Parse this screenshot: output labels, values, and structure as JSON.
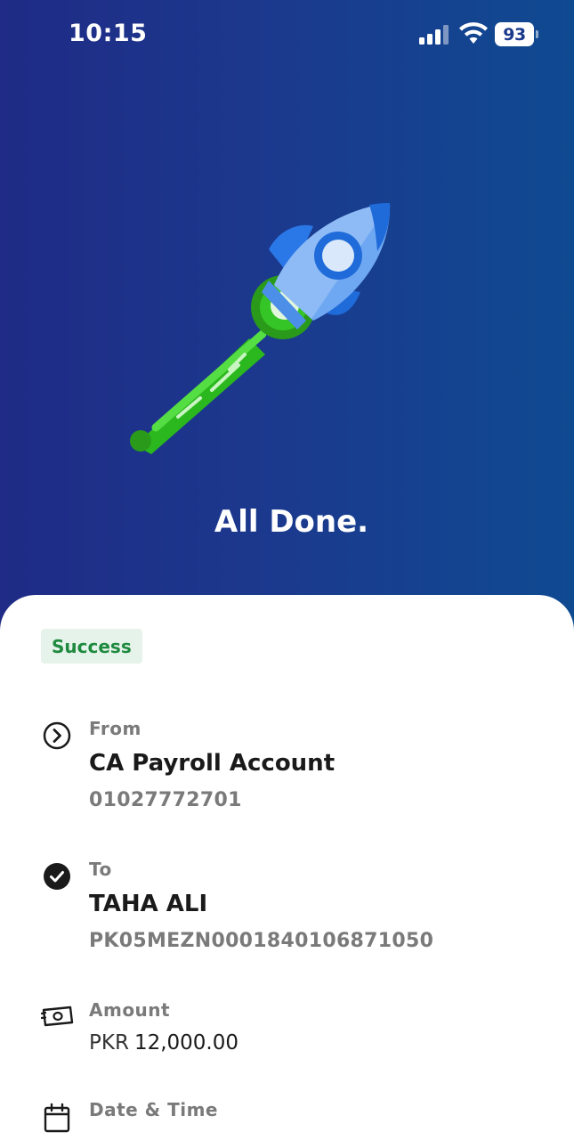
{
  "status_bar": {
    "time": "10:15",
    "battery": "93",
    "icons": [
      "signal-icon",
      "wifi-icon",
      "battery-icon"
    ]
  },
  "hero": {
    "title": "All Done.",
    "illustration": "rocket-illustration",
    "colors": {
      "gradient_start": "#1f2b86",
      "gradient_end": "#0f4a91"
    }
  },
  "status_badge": {
    "label": "Success",
    "color": "#1e8a3f"
  },
  "details": {
    "from": {
      "label": "From",
      "name": "CA Payroll Account",
      "account": "01027772701",
      "icon": "chevron-circle-icon"
    },
    "to": {
      "label": "To",
      "name": "TAHA ALI",
      "account": "PK05MEZN0001840106871050",
      "icon": "check-circle-icon"
    },
    "amount": {
      "label": "Amount",
      "currency": "PKR",
      "value": "12,000.00",
      "icon": "cash-icon"
    },
    "datetime": {
      "label": "Date & Time",
      "icon": "calendar-icon"
    }
  }
}
